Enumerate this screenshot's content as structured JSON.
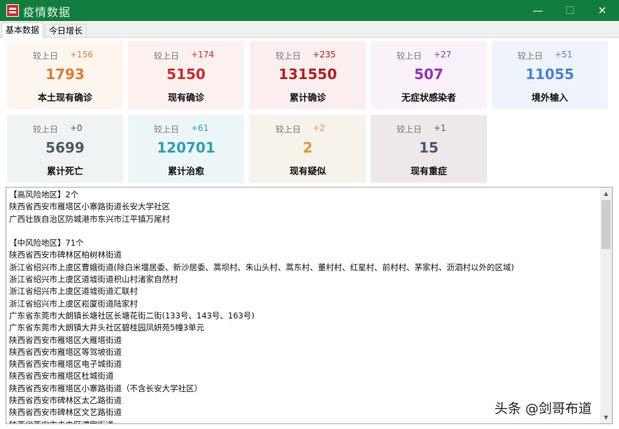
{
  "window": {
    "title": "疫情数据",
    "min_label": "—",
    "max_label": "☐",
    "close_label": "✕"
  },
  "tabs": [
    {
      "label": "基本数据"
    },
    {
      "label": "今日增长"
    }
  ],
  "colors": {
    "titlebar": "#117d3c"
  },
  "cards": [
    {
      "cmp_label": "较上日",
      "change": "+156",
      "value": "1793",
      "name": "本土现有确诊",
      "bg": "#fdf6ef",
      "value_color": "#e07b35",
      "change_color": "#e07b35"
    },
    {
      "cmp_label": "较上日",
      "change": "+174",
      "value": "5150",
      "name": "现有确诊",
      "bg": "#fdf1f0",
      "value_color": "#d42a2a",
      "change_color": "#d42a2a"
    },
    {
      "cmp_label": "较上日",
      "change": "+235",
      "value": "131550",
      "name": "累计确诊",
      "bg": "#fbeeee",
      "value_color": "#b81e1e",
      "change_color": "#b81e1e"
    },
    {
      "cmp_label": "较上日",
      "change": "+27",
      "value": "507",
      "name": "无症状感染者",
      "bg": "#faf2fb",
      "value_color": "#9b33b5",
      "change_color": "#9b33b5"
    },
    {
      "cmp_label": "较上日",
      "change": "+51",
      "value": "11055",
      "name": "境外输入",
      "bg": "#eef3fc",
      "value_color": "#4a84d1",
      "change_color": "#4a84d1"
    },
    {
      "cmp_label": "较上日",
      "change": "+0",
      "value": "5699",
      "name": "累计死亡",
      "bg": "#f0f3f4",
      "value_color": "#4e5b66",
      "change_color": "#4e5b66"
    },
    {
      "cmp_label": "较上日",
      "change": "+61",
      "value": "120701",
      "name": "累计治愈",
      "bg": "#ecf6f8",
      "value_color": "#2ba0b8",
      "change_color": "#2ba0b8"
    },
    {
      "cmp_label": "较上日",
      "change": "+2",
      "value": "2",
      "name": "现有疑似",
      "bg": "#f7f2ea",
      "value_color": "#e39a2a",
      "change_color": "#e39a2a"
    },
    {
      "cmp_label": "较上日",
      "change": "+1",
      "value": "15",
      "name": "现有重症",
      "bg": "#efe8e9",
      "value_color": "#4b5870",
      "change_color": "#4b5870"
    }
  ],
  "risk_text": [
    "【高风险地区】2个",
    "陕西省西安市雁塔区小寨路街道长安大学社区",
    "广西壮族自治区防城港市东兴市江平镇万尾村",
    "",
    "【中风险地区】71个",
    "陕西省西安市碑林区柏树林街道",
    "浙江省绍兴市上虞区曹娥街道(除白米堰居委、新沙居委、蒿坝村、朱山头村、蒿东村、董村村、红星村、前村村、茅家村、沥泗村以外的区域)",
    "浙江省绍兴市上虞区道墟街道积山村渚家自然村",
    "浙江省绍兴市上虞区道墟街道汇联村",
    "浙江省绍兴市上虞区崧厦街道陆家村",
    "广东省东莞市大朗镇长塘社区长塘花街二街(133号、143号、163号)",
    "广东省东莞市大朗镇大井头社区碧桂园凤妍苑5幢3单元",
    "陕西省西安市雁塔区大雁塔街道",
    "陕西省西安市雁塔区等驾坡街道",
    "陕西省西安市雁塔区电子城街道",
    "陕西省西安市雁塔区杜城街道",
    "陕西省西安市雁塔区小寨路街道（不含长安大学社区）",
    "陕西省西安市碑林区太乙路街道",
    "陕西省西安市碑林区文艺路街道",
    "陕西省西安市未央区谭家街道"
  ],
  "scrollbar": {
    "up": "▲",
    "down": "▼"
  },
  "watermark": "头条 @剑哥布道"
}
